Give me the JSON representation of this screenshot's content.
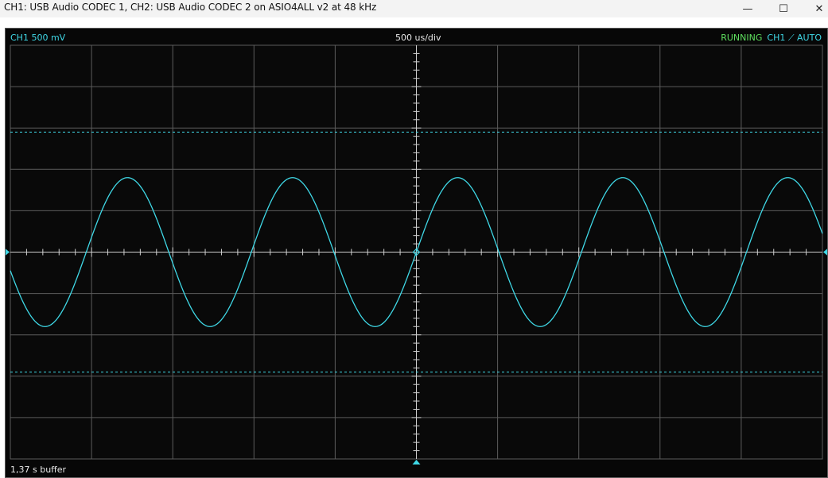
{
  "window": {
    "title": "CH1: USB Audio CODEC  1, CH2: USB Audio CODEC  2 on ASIO4ALL v2 at 48 kHz",
    "minimize_glyph": "—",
    "maximize_glyph": "☐",
    "close_glyph": "✕"
  },
  "scope": {
    "channel_label": "CH1 500 mV",
    "timebase_label": "500 us/div",
    "status": "RUNNING",
    "trigger": "CH1 ⟋ AUTO",
    "buffer_label": "1,37 s buffer"
  },
  "colors": {
    "trace": "#3fd8e6",
    "grid": "#5c5c5c",
    "axis": "#cfcfcf",
    "running": "#5fe05f",
    "background": "#070707"
  },
  "chart_data": {
    "type": "line",
    "xlabel": "",
    "ylabel": "",
    "x_divisions": 10,
    "y_divisions": 10,
    "volts_per_div": 0.5,
    "seconds_per_div": 0.0005,
    "xlim": [
      -0.0025,
      0.0025
    ],
    "ylim": [
      -2.5,
      2.5
    ],
    "grid": true,
    "signal": {
      "shape": "sine",
      "amplitude_v": 0.9,
      "frequency_hz": 984,
      "zero_crossing_t": 0.0,
      "rising_at_zero": true
    },
    "cursors": {
      "upper_level_v": 1.45,
      "lower_level_v": -1.45
    }
  }
}
